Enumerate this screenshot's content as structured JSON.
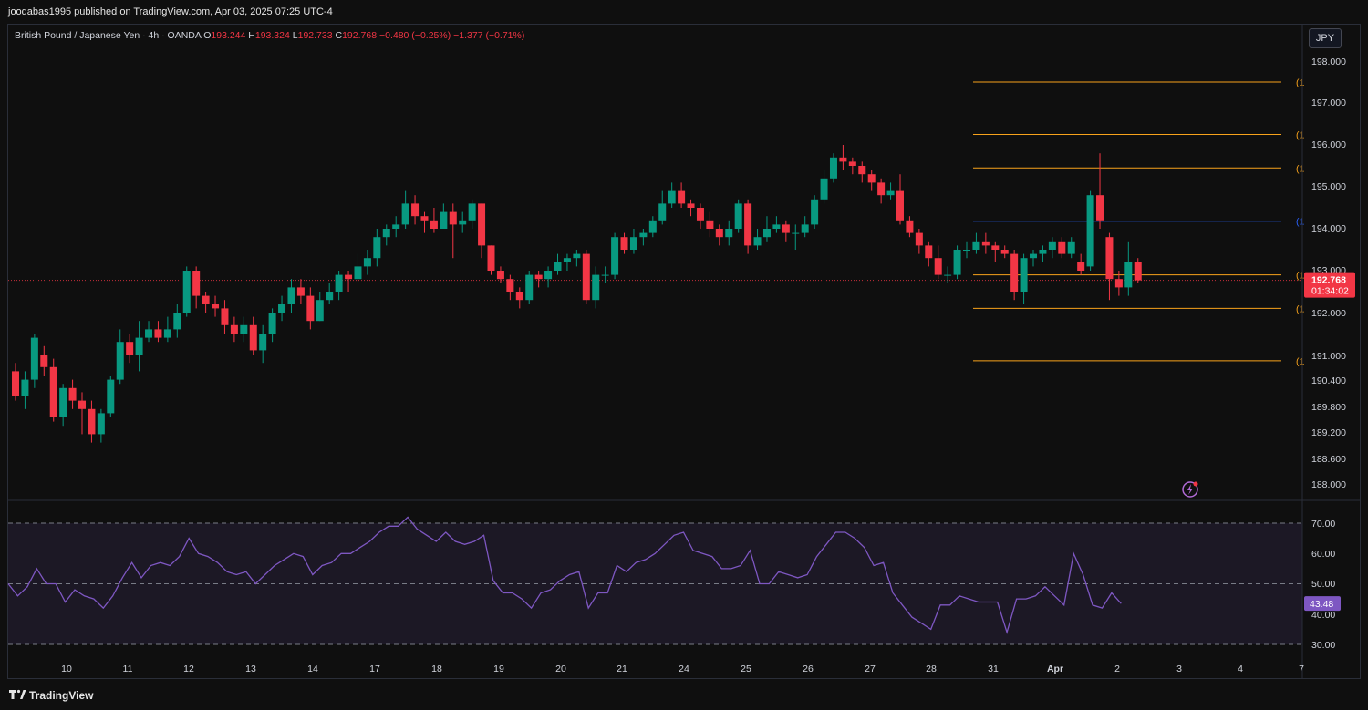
{
  "header": {
    "publisher_line": "joodabas1995 published on TradingView.com, Apr 03, 2025 07:25 UTC-4"
  },
  "legend": {
    "symbol": "British Pound / Japanese Yen · 4h · OANDA",
    "open_label": "O",
    "open": "193.244",
    "high_label": "H",
    "high": "193.324",
    "low_label": "L",
    "low": "192.733",
    "close_label": "C",
    "close": "192.768",
    "change": "−0.480 (−0.25%) −1.377 (−0.71%)"
  },
  "currency_button": "JPY",
  "last_price": {
    "price": "192.768",
    "countdown": "01:34:02"
  },
  "rsi_last": "43.48",
  "level_tag": "(1",
  "footer": {
    "brand": "TradingView"
  },
  "colors": {
    "up": "#089981",
    "down": "#f23645",
    "rsi_line": "#7e57c2",
    "level_orange": "#f7a21b",
    "level_blue": "#2962ff",
    "background": "#0f0f0f"
  },
  "chart_data": {
    "type": "candlestick",
    "y_axis_labels": [
      "198.000",
      "197.000",
      "196.000",
      "195.000",
      "194.000",
      "193.000",
      "192.000",
      "191.000",
      "190.400",
      "189.800",
      "189.200",
      "188.600",
      "188.000"
    ],
    "x_axis_labels": [
      "10",
      "11",
      "12",
      "13",
      "14",
      "17",
      "18",
      "19",
      "20",
      "21",
      "24",
      "25",
      "26",
      "27",
      "28",
      "31",
      "Apr",
      "2",
      "3",
      "4",
      "7"
    ],
    "horizontal_levels": [
      {
        "price": 197.5,
        "color": "orange"
      },
      {
        "price": 196.25,
        "color": "orange"
      },
      {
        "price": 195.45,
        "color": "orange"
      },
      {
        "price": 194.18,
        "color": "blue"
      },
      {
        "price": 192.9,
        "color": "orange"
      },
      {
        "price": 192.1,
        "color": "orange"
      },
      {
        "price": 190.85,
        "color": "orange"
      }
    ],
    "candles": [
      [
        190.6,
        190.0,
        190.8,
        189.9
      ],
      [
        190.0,
        190.4,
        190.6,
        189.7
      ],
      [
        190.4,
        191.4,
        191.5,
        190.2
      ],
      [
        191.0,
        190.7,
        191.2,
        190.5
      ],
      [
        190.7,
        189.5,
        190.9,
        189.4
      ],
      [
        189.5,
        190.2,
        190.3,
        189.3
      ],
      [
        190.2,
        189.9,
        190.4,
        189.7
      ],
      [
        189.9,
        189.7,
        190.1,
        189.1
      ],
      [
        189.7,
        189.1,
        189.9,
        188.9
      ],
      [
        189.1,
        189.6,
        189.7,
        188.9
      ],
      [
        189.6,
        190.4,
        190.5,
        189.5
      ],
      [
        190.4,
        191.3,
        191.6,
        190.3
      ],
      [
        191.3,
        191.0,
        191.5,
        190.8
      ],
      [
        191.0,
        191.4,
        191.8,
        190.6
      ],
      [
        191.4,
        191.6,
        191.8,
        191.3
      ],
      [
        191.6,
        191.4,
        191.8,
        191.3
      ],
      [
        191.4,
        191.6,
        191.9,
        191.3
      ],
      [
        191.6,
        192.0,
        192.2,
        191.4
      ],
      [
        192.0,
        193.0,
        193.1,
        191.9
      ],
      [
        193.0,
        192.4,
        193.1,
        192.1
      ],
      [
        192.4,
        192.2,
        192.5,
        192.0
      ],
      [
        192.2,
        192.1,
        192.4,
        191.9
      ],
      [
        192.1,
        191.7,
        192.3,
        191.5
      ],
      [
        191.7,
        191.5,
        191.9,
        191.3
      ],
      [
        191.5,
        191.7,
        191.9,
        191.3
      ],
      [
        191.7,
        191.1,
        191.9,
        191.0
      ],
      [
        191.1,
        191.5,
        191.7,
        190.8
      ],
      [
        191.5,
        192.0,
        192.1,
        191.3
      ],
      [
        192.0,
        192.2,
        192.4,
        191.8
      ],
      [
        192.2,
        192.6,
        192.8,
        192.0
      ],
      [
        192.6,
        192.4,
        192.8,
        192.2
      ],
      [
        192.4,
        191.8,
        192.6,
        191.6
      ],
      [
        191.8,
        192.3,
        192.5,
        191.8
      ],
      [
        192.3,
        192.5,
        192.7,
        192.2
      ],
      [
        192.5,
        192.9,
        193.0,
        192.3
      ],
      [
        192.9,
        192.8,
        193.0,
        192.5
      ],
      [
        192.8,
        193.1,
        193.4,
        192.7
      ],
      [
        193.1,
        193.3,
        193.5,
        192.9
      ],
      [
        193.3,
        193.8,
        194.0,
        193.1
      ],
      [
        193.8,
        194.0,
        194.1,
        193.6
      ],
      [
        194.0,
        194.1,
        194.3,
        193.8
      ],
      [
        194.1,
        194.6,
        194.9,
        194.0
      ],
      [
        194.6,
        194.3,
        194.8,
        194.1
      ],
      [
        194.3,
        194.2,
        194.4,
        193.9
      ],
      [
        194.2,
        194.0,
        194.5,
        193.9
      ],
      [
        194.0,
        194.4,
        194.6,
        194.0
      ],
      [
        194.4,
        194.1,
        194.6,
        193.3
      ],
      [
        194.1,
        194.2,
        194.4,
        193.9
      ],
      [
        194.2,
        194.6,
        194.7,
        194.0
      ],
      [
        194.6,
        193.6,
        194.6,
        193.3
      ],
      [
        193.6,
        193.0,
        193.6,
        192.9
      ],
      [
        193.0,
        192.8,
        193.1,
        192.7
      ],
      [
        192.8,
        192.5,
        192.9,
        192.3
      ],
      [
        192.5,
        192.3,
        192.6,
        192.1
      ],
      [
        192.3,
        192.9,
        193.0,
        192.2
      ],
      [
        192.9,
        192.8,
        193.0,
        192.6
      ],
      [
        192.8,
        193.0,
        193.1,
        192.6
      ],
      [
        193.0,
        193.2,
        193.4,
        192.9
      ],
      [
        193.2,
        193.3,
        193.4,
        193.0
      ],
      [
        193.3,
        193.4,
        193.5,
        193.1
      ],
      [
        193.4,
        192.3,
        193.5,
        192.2
      ],
      [
        192.3,
        192.9,
        193.1,
        192.1
      ],
      [
        192.9,
        192.9,
        193.1,
        192.7
      ],
      [
        192.9,
        193.8,
        193.9,
        192.8
      ],
      [
        193.8,
        193.5,
        193.9,
        193.4
      ],
      [
        193.5,
        193.8,
        194.0,
        193.4
      ],
      [
        193.8,
        193.9,
        194.0,
        193.6
      ],
      [
        193.9,
        194.2,
        194.3,
        193.8
      ],
      [
        194.2,
        194.6,
        194.9,
        194.1
      ],
      [
        194.6,
        194.9,
        195.1,
        194.5
      ],
      [
        194.9,
        194.6,
        195.1,
        194.5
      ],
      [
        194.6,
        194.5,
        194.7,
        194.3
      ],
      [
        194.5,
        194.2,
        194.6,
        194.0
      ],
      [
        194.2,
        194.0,
        194.4,
        193.8
      ],
      [
        194.0,
        193.8,
        194.1,
        193.6
      ],
      [
        193.8,
        194.0,
        194.2,
        193.6
      ],
      [
        194.0,
        194.6,
        194.7,
        193.9
      ],
      [
        194.6,
        193.6,
        194.7,
        193.4
      ],
      [
        193.6,
        193.8,
        194.0,
        193.5
      ],
      [
        193.8,
        194.0,
        194.3,
        193.7
      ],
      [
        194.0,
        194.1,
        194.3,
        193.9
      ],
      [
        194.1,
        193.9,
        194.2,
        193.7
      ],
      [
        193.9,
        193.9,
        194.1,
        193.5
      ],
      [
        193.9,
        194.1,
        194.3,
        193.8
      ],
      [
        194.1,
        194.7,
        194.8,
        194.0
      ],
      [
        194.7,
        195.2,
        195.4,
        194.6
      ],
      [
        195.2,
        195.7,
        195.8,
        195.1
      ],
      [
        195.7,
        195.6,
        196.0,
        195.4
      ],
      [
        195.6,
        195.5,
        195.7,
        195.3
      ],
      [
        195.5,
        195.3,
        195.6,
        195.1
      ],
      [
        195.3,
        195.1,
        195.4,
        194.9
      ],
      [
        195.1,
        194.8,
        195.2,
        194.6
      ],
      [
        194.8,
        194.9,
        195.1,
        194.7
      ],
      [
        194.9,
        194.2,
        195.3,
        194.1
      ],
      [
        194.2,
        193.9,
        194.3,
        193.8
      ],
      [
        193.9,
        193.6,
        194.0,
        193.4
      ],
      [
        193.6,
        193.3,
        193.7,
        193.1
      ],
      [
        193.3,
        192.9,
        193.6,
        192.8
      ],
      [
        192.9,
        192.9,
        193.1,
        192.7
      ],
      [
        192.9,
        193.5,
        193.6,
        192.8
      ],
      [
        193.5,
        193.5,
        193.7,
        193.3
      ],
      [
        193.5,
        193.7,
        193.9,
        193.4
      ],
      [
        193.7,
        193.6,
        193.9,
        193.4
      ],
      [
        193.6,
        193.5,
        193.7,
        193.2
      ],
      [
        193.5,
        193.4,
        193.6,
        193.3
      ],
      [
        193.4,
        192.5,
        193.5,
        192.3
      ],
      [
        192.5,
        193.3,
        193.4,
        192.2
      ],
      [
        193.3,
        193.4,
        193.5,
        193.1
      ],
      [
        193.4,
        193.5,
        193.6,
        193.2
      ],
      [
        193.5,
        193.7,
        193.8,
        193.3
      ],
      [
        193.7,
        193.4,
        193.8,
        193.3
      ],
      [
        193.4,
        193.7,
        193.8,
        193.3
      ],
      [
        193.2,
        193.0,
        193.4,
        192.9
      ],
      [
        193.1,
        194.8,
        194.9,
        193.0
      ],
      [
        194.8,
        194.2,
        195.8,
        194.0
      ],
      [
        193.8,
        192.8,
        193.9,
        192.3
      ],
      [
        192.8,
        192.6,
        193.0,
        192.4
      ],
      [
        192.6,
        193.2,
        193.7,
        192.4
      ],
      [
        193.2,
        192.77,
        193.3,
        192.7
      ]
    ],
    "rsi": {
      "levels": [
        70,
        50,
        30
      ],
      "y_axis_labels": [
        "70.00",
        "60.00",
        "50.00",
        "40.00",
        "30.00"
      ],
      "values": [
        50,
        46,
        49,
        55,
        50,
        50,
        44,
        48,
        46,
        45,
        42,
        46,
        52,
        57,
        52,
        56,
        57,
        56,
        59,
        65,
        60,
        59,
        57,
        54,
        53,
        54,
        50,
        53,
        56,
        58,
        60,
        59,
        53,
        56,
        57,
        60,
        60,
        62,
        64,
        67,
        69,
        69,
        72,
        68,
        66,
        64,
        67,
        64,
        63,
        64,
        66,
        51,
        47,
        47,
        45,
        42,
        47,
        48,
        51,
        53,
        54,
        42,
        47,
        47,
        56,
        54,
        57,
        58,
        60,
        63,
        66,
        67,
        61,
        60,
        59,
        55,
        55,
        56,
        61,
        50,
        50,
        54,
        53,
        52,
        53,
        59,
        63,
        67,
        67,
        65,
        62,
        56,
        57,
        47,
        43,
        39,
        37,
        35,
        43,
        43,
        46,
        45,
        44,
        44,
        44,
        34,
        45,
        45,
        46,
        49,
        46,
        43,
        60,
        53,
        43,
        42,
        47,
        43.48
      ]
    }
  }
}
